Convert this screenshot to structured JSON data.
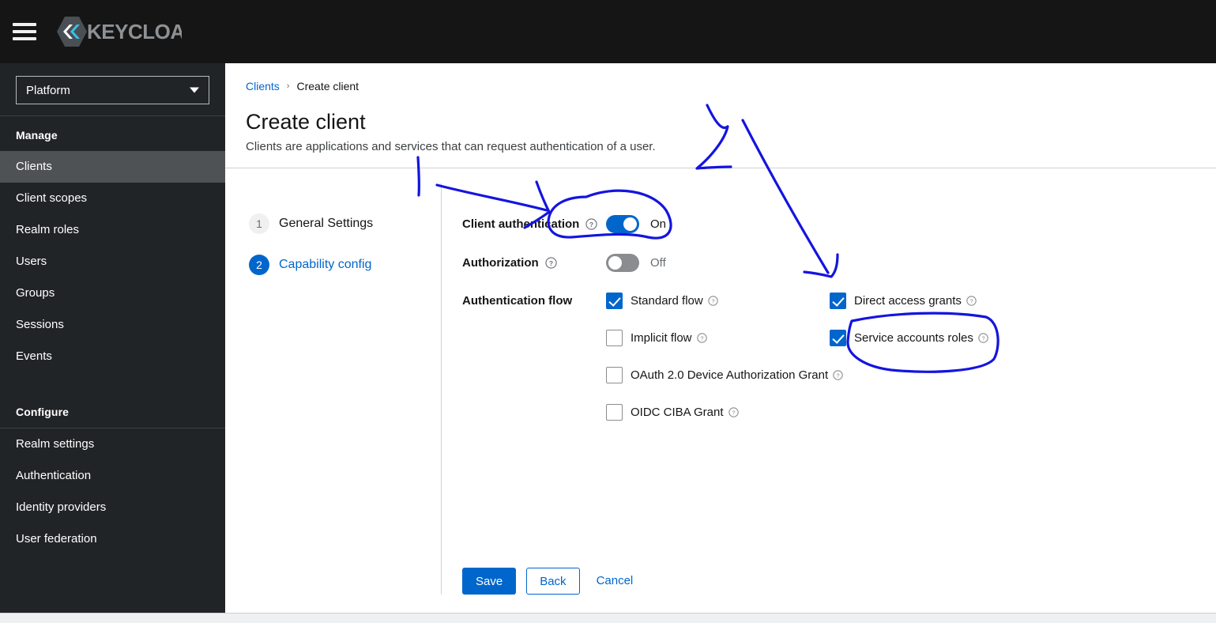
{
  "masthead": {
    "menu_icon": "hamburger-icon",
    "brand_text": "KEYCLOAK",
    "brand_logo_icon": "keycloak-hexagon-logo"
  },
  "sidebar": {
    "realm_selector": {
      "value": "Platform",
      "caret_icon": "chevron-down-icon"
    },
    "groups": [
      {
        "title": "Manage",
        "items": [
          {
            "label": "Clients",
            "active": true
          },
          {
            "label": "Client scopes",
            "active": false
          },
          {
            "label": "Realm roles",
            "active": false
          },
          {
            "label": "Users",
            "active": false
          },
          {
            "label": "Groups",
            "active": false
          },
          {
            "label": "Sessions",
            "active": false
          },
          {
            "label": "Events",
            "active": false
          }
        ]
      },
      {
        "title": "Configure",
        "items": [
          {
            "label": "Realm settings",
            "active": false
          },
          {
            "label": "Authentication",
            "active": false
          },
          {
            "label": "Identity providers",
            "active": false
          },
          {
            "label": "User federation",
            "active": false
          }
        ]
      }
    ]
  },
  "header": {
    "breadcrumb": {
      "parent": "Clients",
      "separator": "›",
      "current": "Create client"
    },
    "title": "Create client",
    "description": "Clients are applications and services that can request authentication of a user."
  },
  "wizard": {
    "steps": [
      {
        "number": "1",
        "label": "General Settings",
        "state": "done"
      },
      {
        "number": "2",
        "label": "Capability config",
        "state": "current"
      }
    ],
    "fields": {
      "client_authentication": {
        "label": "Client authentication",
        "help_icon": "question-circle-icon",
        "state": "on",
        "state_label": "On"
      },
      "authorization": {
        "label": "Authorization",
        "help_icon": "question-circle-icon",
        "state": "off",
        "state_label": "Off"
      },
      "authentication_flow": {
        "label": "Authentication flow",
        "options": [
          {
            "label": "Standard flow",
            "checked": true,
            "help_icon": "question-circle-icon",
            "column": "left"
          },
          {
            "label": "Direct access grants",
            "checked": true,
            "help_icon": "question-circle-icon",
            "column": "right"
          },
          {
            "label": "Implicit flow",
            "checked": false,
            "help_icon": "question-circle-icon",
            "column": "left"
          },
          {
            "label": "Service accounts roles",
            "checked": true,
            "help_icon": "question-circle-icon",
            "column": "right"
          },
          {
            "label": "OAuth 2.0 Device Authorization Grant",
            "checked": false,
            "help_icon": "question-circle-icon",
            "column": "left"
          },
          {
            "label": "OIDC CIBA Grant",
            "checked": false,
            "help_icon": "question-circle-icon",
            "column": "left"
          }
        ]
      }
    },
    "footer": {
      "save_label": "Save",
      "back_label": "Back",
      "cancel_label": "Cancel"
    }
  },
  "annotations": {
    "ink_color": "#1414e0",
    "marks": [
      {
        "name": "circle-around-client-authentication-toggle",
        "shape": "ellipse"
      },
      {
        "name": "arrow-pointing-to-client-authentication",
        "shape": "arrow"
      },
      {
        "name": "vertical-tick-left",
        "shape": "line"
      },
      {
        "name": "check-mark-top-right",
        "shape": "polyline"
      },
      {
        "name": "long-diagonal-arrow-to-direct-access-grants",
        "shape": "arrow"
      },
      {
        "name": "circle-around-service-accounts-roles",
        "shape": "ellipse"
      }
    ]
  },
  "colors": {
    "masthead_bg": "#151515",
    "sidebar_bg": "#212427",
    "sidebar_active_bg": "#4f5255",
    "accent_blue": "#0066cc",
    "toggle_off_gray": "#8a8d90",
    "ink_blue": "#1414e0"
  }
}
